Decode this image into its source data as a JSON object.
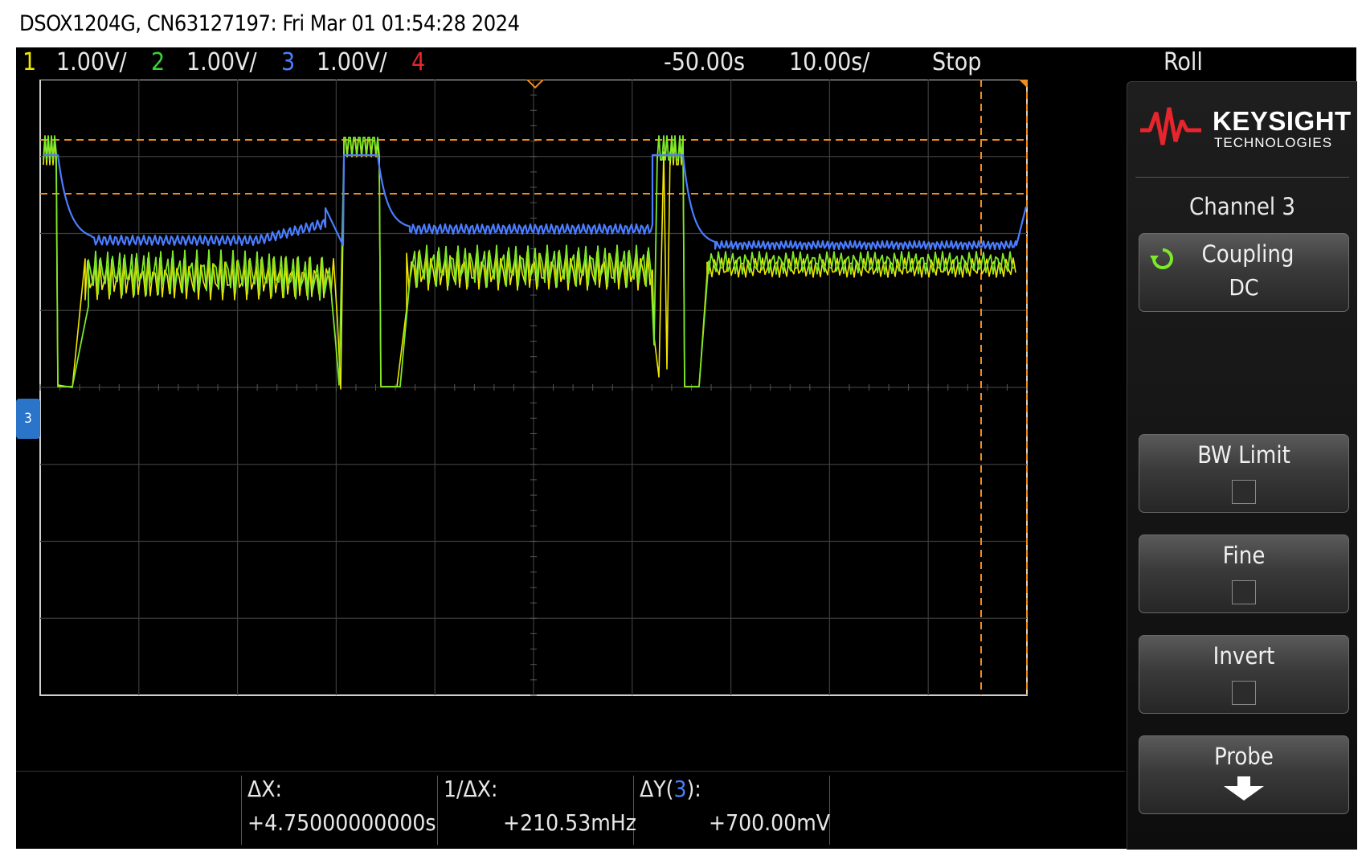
{
  "title": "DSOX1204G, CN63127197: Fri Mar 01 01:54:28 2024",
  "topbar": {
    "ch1_num": "1",
    "ch1_scale": "1.00V/",
    "ch2_num": "2",
    "ch2_scale": "1.00V/",
    "ch3_num": "3",
    "ch3_scale": "1.00V/",
    "ch4_num": "4",
    "delay": "-50.00s",
    "timebase": "10.00s/",
    "run_state": "Stop",
    "mode": "Roll"
  },
  "ground_marker": "3",
  "panel": {
    "logo_line1": "KEYSIGHT",
    "logo_line2": "TECHNOLOGIES",
    "title": "Channel 3",
    "coupling_label": "Coupling",
    "coupling_value": "DC",
    "bw_limit_label": "BW Limit",
    "fine_label": "Fine",
    "invert_label": "Invert",
    "probe_label": "Probe"
  },
  "measurements": {
    "dx_label": "ΔX:",
    "dx_value": "+4.75000000000s",
    "inv_dx_label": "1/ΔX:",
    "inv_dx_value": "+210.53mHz",
    "dy_label_prefix": "ΔY(",
    "dy_channel": "3",
    "dy_label_suffix": "):",
    "dy_value": "+700.00mV"
  },
  "colors": {
    "ch1": "#f2e600",
    "ch2": "#39d23a",
    "ch3": "#4a7dff",
    "ch4": "#e8242c",
    "cursor": "#f08c1e",
    "grid": "#3c3c3c"
  }
}
